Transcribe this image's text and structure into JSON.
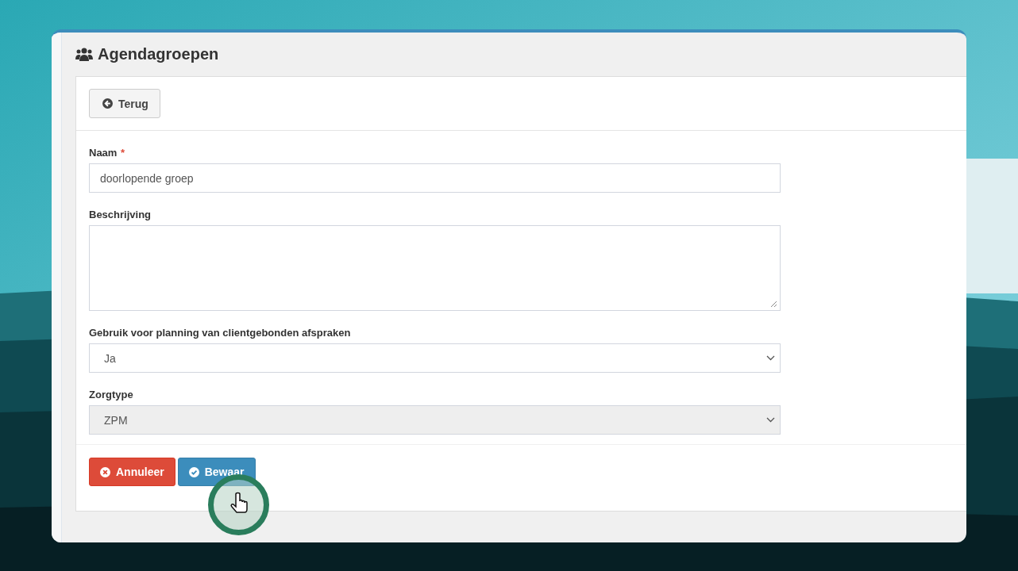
{
  "page": {
    "title": "Agendagroepen"
  },
  "back_button": {
    "label": "Terug"
  },
  "fields": [
    {
      "kind": "text",
      "label": "Naam",
      "required_mark": "*",
      "value": "doorlopende groep",
      "disabled": false
    },
    {
      "kind": "textarea",
      "label": "Beschrijving",
      "disabled": false
    },
    {
      "kind": "select",
      "label": "Gebruik voor planning van clientgebonden afspraken",
      "value": "Ja",
      "disabled": false
    },
    {
      "kind": "select",
      "label": "Zorgtype",
      "value": "ZPM",
      "disabled": true
    }
  ],
  "buttons": [
    {
      "kind": "cancel",
      "label": "Annuleer"
    },
    {
      "kind": "save",
      "label": "Bewaar"
    }
  ]
}
